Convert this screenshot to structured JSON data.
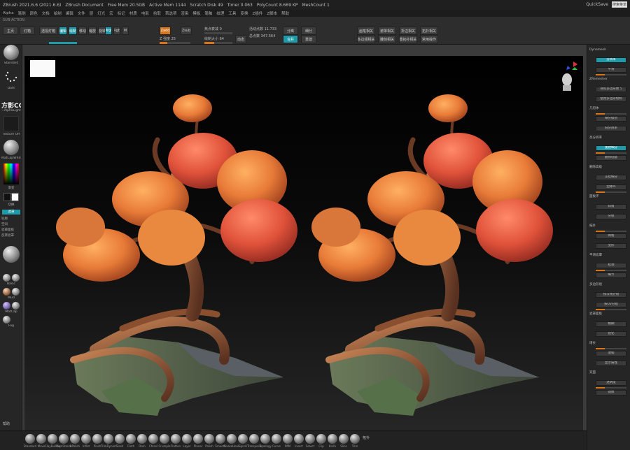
{
  "window": {
    "title_items": [
      "ZBrush 2021.6.6 (2021.6.6)",
      "ZBrush Document",
      "Free Mem 20.5GB",
      "Active Mem 1144",
      "Scratch Disk 49",
      "Timer 0.063",
      "PolyCount 8.669 KP",
      "MeshCount 1"
    ],
    "quicksave_label": "QuickSave",
    "search_label": "搜索菜单",
    "accent": "#d8751a",
    "active": "#1e9aa8"
  },
  "menubar": {
    "items": [
      "Alpha",
      "笔刷",
      "颜色",
      "文档",
      "绘制",
      "编辑",
      "文件",
      "层",
      "灯光",
      "宏",
      "标记",
      "材质",
      "电影",
      "拾取",
      "首选项",
      "渲染",
      "模板",
      "笔触",
      "纹理",
      "工具",
      "变换",
      "Z插件",
      "Z脚本",
      "帮助"
    ]
  },
  "toolbar": {
    "caption": "SUB-ACTION",
    "home_label": "主页",
    "lightbox_label": "灯箱",
    "preview_label": "透视灯箱",
    "edit_label": "编辑",
    "draw_label": "绘制",
    "move_label": "移动",
    "scale_label": "缩放",
    "rotate_label": "旋转",
    "mrgb_label": "Mrgb",
    "rgb_label": "Rgb",
    "m_label": "M",
    "zadd_label": "Zadd",
    "zsub_label": "Zsub",
    "z_intensity_label": "Z 强度 25",
    "focal_label": "焦点衰减 0",
    "draw_size_label": "绘制大小 64",
    "dynamic_label": "动态",
    "active_points_label": "活动点数 11.733",
    "total_points_label": "总点数 347.564",
    "intensity_value": 0.25,
    "buttons": [
      "分离",
      "合并",
      "细分",
      "重建"
    ],
    "right_buttons": [
      "画笔相关",
      "遮罩相关",
      "折边相关",
      "拓扑相关",
      "多边组相关",
      "雕刻相关",
      "重拓扑相关",
      "常用操作"
    ]
  },
  "leftpanel": {
    "standard_label": "Standard",
    "dots_label": "Dots",
    "logo_text": "方影CG",
    "alpha_label": "~AlphaLights",
    "texture_label": "Texture Off",
    "matcap_label": "MatCapWhite01",
    "gradient_label": "渐变",
    "switch_label": "切换",
    "mask_label": "遮罩",
    "items": [
      "轮廓",
      "空间",
      "遮罩面板",
      "反转遮罩"
    ],
    "brush_items": [
      "Basic",
      "Smooth",
      "Mud",
      "MatCap",
      "MatCap",
      "BasicMat",
      "Fog"
    ]
  },
  "rightpanel": {
    "items": [
      "Dynamesh",
      "分辨率",
      "平滑",
      "ZRemesher",
      "目标多边形数 5",
      "使用多边形绘制",
      "几何体",
      "细分级别",
      "低分辨率",
      "高分辨率",
      "重建细分",
      "删除低级",
      "删除高级",
      "冻结细分",
      "边缘环",
      "面板环",
      "斜角",
      "分组",
      "拓扑",
      "网格",
      "变形",
      "平滑遮罩",
      "松弛",
      "细节",
      "多边形组",
      "按法线分组",
      "按UV分组",
      "遮罩面板",
      "模糊",
      "锐化",
      "增长",
      "收缩",
      "显示属性",
      "双面",
      "透明度",
      "镜像"
    ]
  },
  "bottomshelf": {
    "brushes": [
      "Standard",
      "Move",
      "ClayBuildup",
      "DamStandard",
      "hPolish",
      "Inflat",
      "Pinch",
      "TrimDynamic",
      "Slash",
      "Cloth",
      "Dam",
      "Chisel",
      "Crumple",
      "Flatten",
      "Layer",
      "Planar",
      "Polish",
      "Smooth",
      "SnakeHook",
      "Spiral",
      "Transpose",
      "Topology",
      "Curve",
      "IMM",
      "Insert",
      "Select",
      "Clip",
      "Knife",
      "Slice",
      "Trim"
    ],
    "mode_label": "拓扑",
    "help_label": "帮助"
  }
}
